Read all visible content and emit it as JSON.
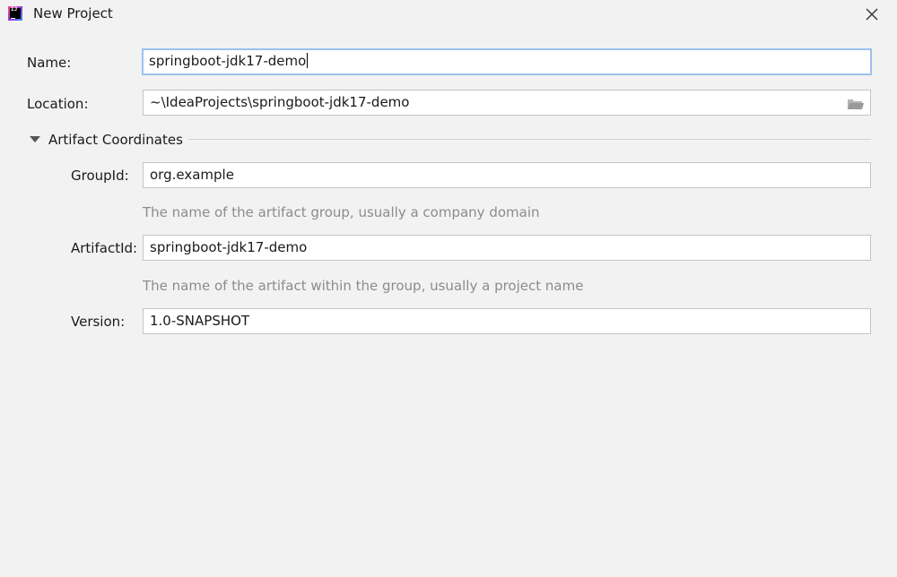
{
  "window": {
    "title": "New Project",
    "app_icon": "intellij-idea-icon",
    "app_icon_text": "IJ"
  },
  "form": {
    "name": {
      "label": "Name:",
      "value": "springboot-jdk17-demo"
    },
    "location": {
      "label": "Location:",
      "value": "~\\IdeaProjects\\springboot-jdk17-demo",
      "browse_icon": "folder-icon"
    },
    "artifact_section": {
      "title": "Artifact Coordinates",
      "expanded": true
    },
    "group_id": {
      "label": "GroupId:",
      "value": "org.example",
      "hint": "The name of the artifact group, usually a company domain"
    },
    "artifact_id": {
      "label": "ArtifactId:",
      "value": "springboot-jdk17-demo",
      "hint": "The name of the artifact within the group, usually a project name"
    },
    "version": {
      "label": "Version:",
      "value": "1.0-SNAPSHOT"
    }
  },
  "colors": {
    "background": "#f2f2f2",
    "focus_border": "#9cc1ec",
    "hint_text": "#8c8c8c"
  }
}
